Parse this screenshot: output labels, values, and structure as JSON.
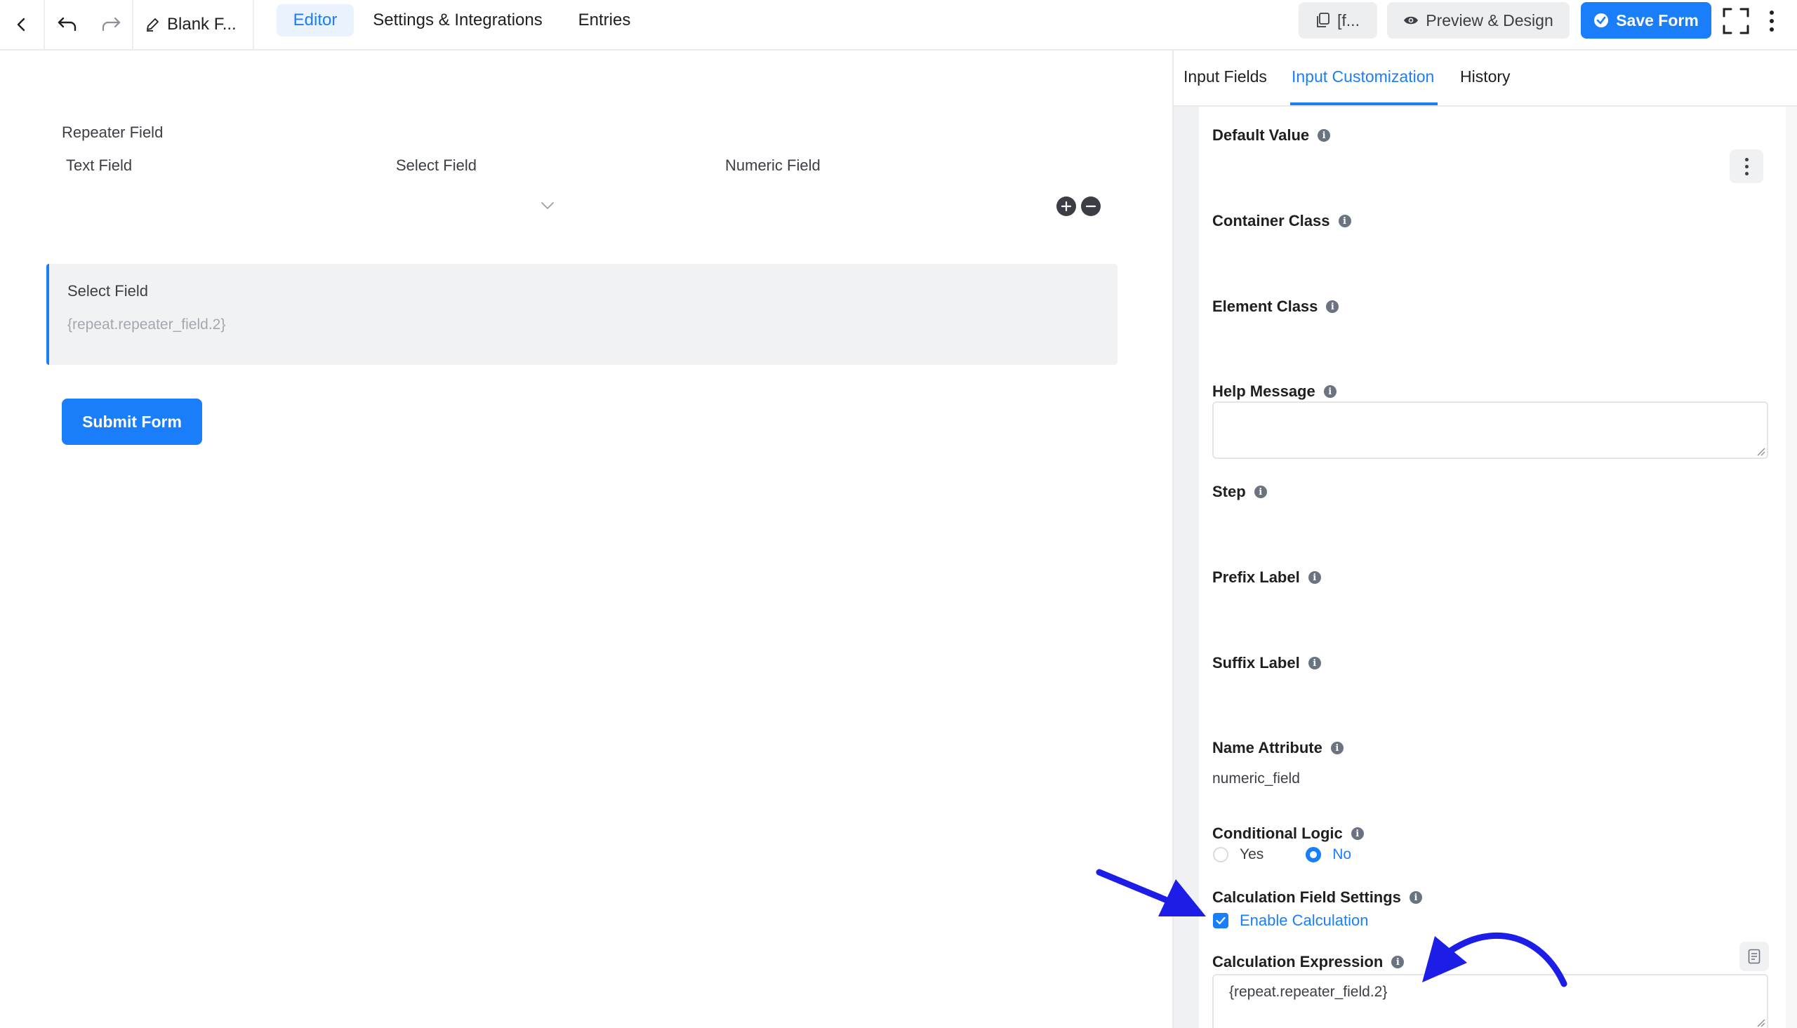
{
  "topbar": {
    "form_title": "Blank F...",
    "tabs": [
      "Editor",
      "Settings & Integrations",
      "Entries"
    ],
    "shortcode_label": "[f...",
    "preview_label": "Preview & Design",
    "save_label": "Save Form"
  },
  "canvas": {
    "repeater_title": "Repeater Field",
    "columns": [
      "Text Field",
      "Select Field",
      "Numeric Field"
    ],
    "select_field": {
      "label": "Select Field",
      "placeholder": "{repeat.repeater_field.2}"
    },
    "submit_label": "Submit Form"
  },
  "panel": {
    "tabs": [
      "Input Fields",
      "Input Customization",
      "History"
    ],
    "fields": {
      "default_value": "Default Value",
      "container_class": "Container Class",
      "element_class": "Element Class",
      "help_message": "Help Message",
      "step": "Step",
      "prefix_label": "Prefix Label",
      "suffix_label": "Suffix Label",
      "name_attribute": "Name Attribute",
      "name_attribute_value": "numeric_field",
      "conditional_logic": "Conditional Logic",
      "conditional_yes": "Yes",
      "conditional_no": "No",
      "calc_settings": "Calculation Field Settings",
      "enable_calc": "Enable Calculation",
      "calc_expression": "Calculation Expression",
      "calc_expression_value": "{repeat.repeater_field.2}"
    }
  },
  "colors": {
    "accent": "#1a7efb",
    "annotation_arrow": "#1c1ee8"
  }
}
